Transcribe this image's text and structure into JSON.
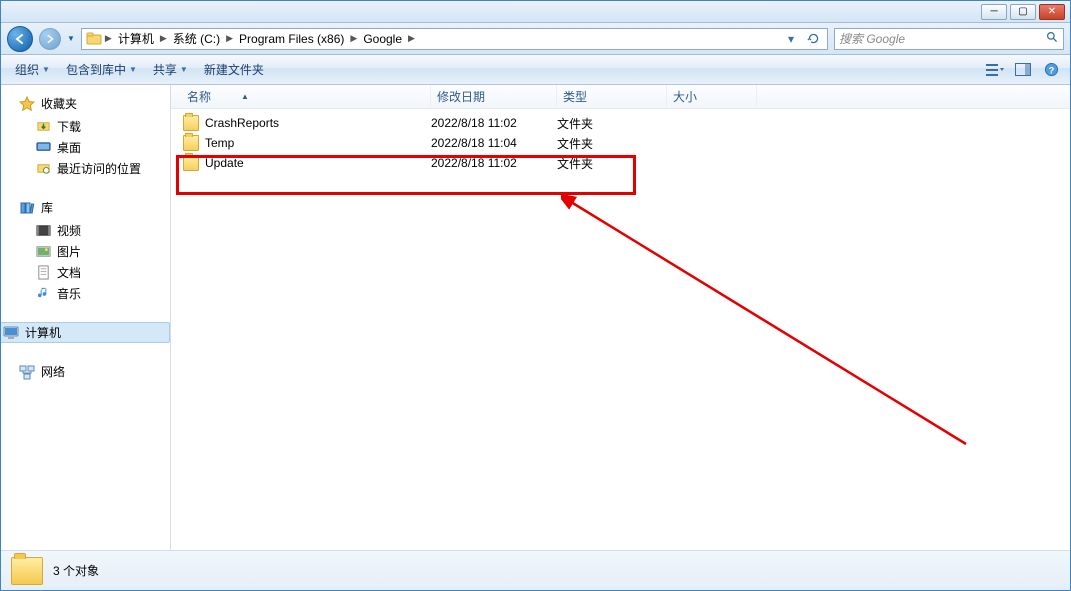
{
  "titlebar": {
    "minimize": "─",
    "maximize": "▢",
    "close": "✕"
  },
  "breadcrumb": {
    "items": [
      {
        "label": "计算机"
      },
      {
        "label": "系统 (C:)"
      },
      {
        "label": "Program Files (x86)"
      },
      {
        "label": "Google"
      }
    ],
    "refresh": "↻"
  },
  "search": {
    "placeholder": "搜索 Google"
  },
  "toolbar": {
    "organize": "组织",
    "include": "包含到库中",
    "share": "共享",
    "new_folder": "新建文件夹"
  },
  "sidebar": {
    "favorites": {
      "label": "收藏夹",
      "items": [
        {
          "label": "下载"
        },
        {
          "label": "桌面"
        },
        {
          "label": "最近访问的位置"
        }
      ]
    },
    "libraries": {
      "label": "库",
      "items": [
        {
          "label": "视频"
        },
        {
          "label": "图片"
        },
        {
          "label": "文档"
        },
        {
          "label": "音乐"
        }
      ]
    },
    "computer": {
      "label": "计算机"
    },
    "network": {
      "label": "网络"
    }
  },
  "columns": {
    "name": "名称",
    "date": "修改日期",
    "type": "类型",
    "size": "大小"
  },
  "rows": [
    {
      "name": "CrashReports",
      "date": "2022/8/18 11:02",
      "type": "文件夹"
    },
    {
      "name": "Temp",
      "date": "2022/8/18 11:04",
      "type": "文件夹"
    },
    {
      "name": "Update",
      "date": "2022/8/18 11:02",
      "type": "文件夹"
    }
  ],
  "status": {
    "text": "3 个对象"
  }
}
